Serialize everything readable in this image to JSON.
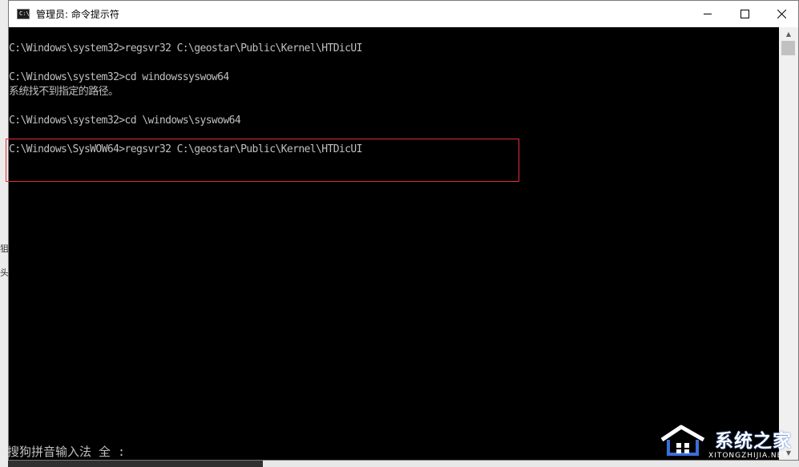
{
  "window": {
    "title": "管理员: 命令提示符",
    "icon": "console-icon",
    "icon_text": "C:\\"
  },
  "console": {
    "lines": [
      "C:\\Windows\\system32>regsvr32 C:\\geostar\\Public\\Kernel\\HTDicUI",
      "",
      "C:\\Windows\\system32>cd windowssyswow64",
      "系统找不到指定的路径。",
      "",
      "C:\\Windows\\system32>cd \\windows\\syswow64",
      "",
      "C:\\Windows\\SysWOW64>regsvr32 C:\\geostar\\Public\\Kernel\\HTDicUI"
    ],
    "highlight_color": "#e0303a"
  },
  "ime": {
    "status": "搜狗拼音输入法 全 :"
  },
  "watermark": {
    "text": "系统之家",
    "sub": "XITONGZHIJIA.NET"
  },
  "background_window": {
    "marks": [
      "狙",
      "头"
    ]
  },
  "colors": {
    "console_bg": "#000000",
    "console_fg": "#c0c0c0",
    "titlebar_bg": "#ffffff"
  }
}
